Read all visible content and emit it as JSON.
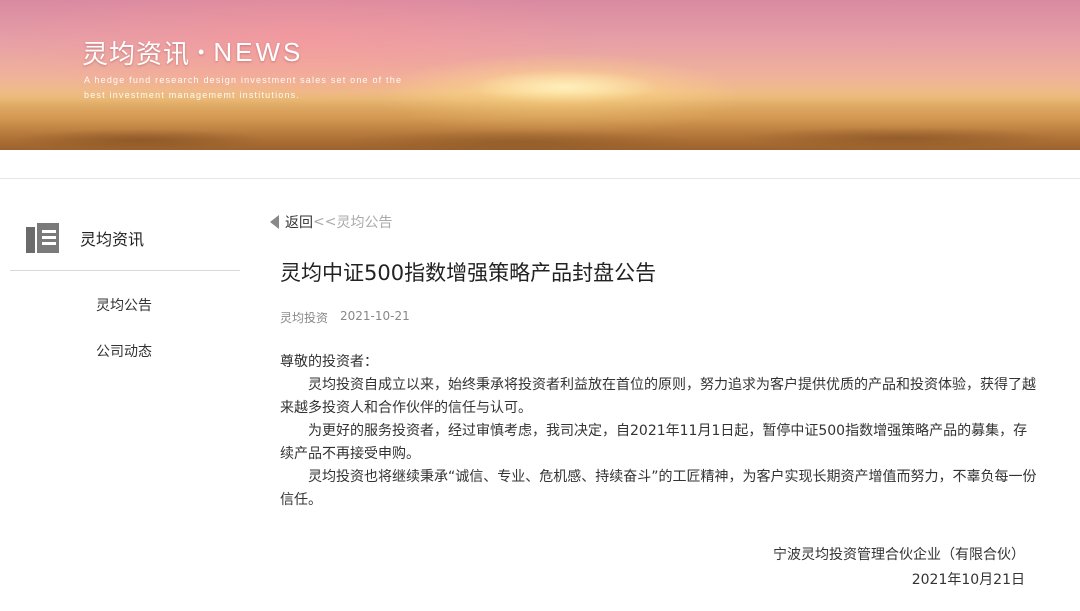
{
  "banner": {
    "title_cn": "灵均资讯",
    "dot": "•",
    "title_en": "NEWS",
    "tagline": "A hedge fund research design investment sales set one of the best investment managememt institutions."
  },
  "sidebar": {
    "icon": "document-icon",
    "title": "灵均资讯",
    "items": [
      {
        "label": "灵均公告"
      },
      {
        "label": "公司动态"
      }
    ]
  },
  "breadcrumb": {
    "back_label": "返回",
    "separator": "<<",
    "current": "灵均公告"
  },
  "article": {
    "title": "灵均中证500指数增强策略产品封盘公告",
    "source": "灵均投资",
    "date": "2021-10-21",
    "salutation": "尊敬的投资者：",
    "paragraphs": [
      "灵均投资自成立以来，始终秉承将投资者利益放在首位的原则，努力追求为客户提供优质的产品和投资体验，获得了越来越多投资人和合作伙伴的信任与认可。",
      "为更好的服务投资者，经过审慎考虑，我司决定，自2021年11月1日起，暂停中证500指数增强策略产品的募集，存续产品不再接受申购。",
      "灵均投资也将继续秉承“诚信、专业、危机感、持续奋斗”的工匠精神，为客户实现长期资产增值而努力，不辜负每一份信任。"
    ],
    "signature_company": "宁波灵均投资管理合伙企业（有限合伙）",
    "signature_date": "2021年10月21日"
  }
}
